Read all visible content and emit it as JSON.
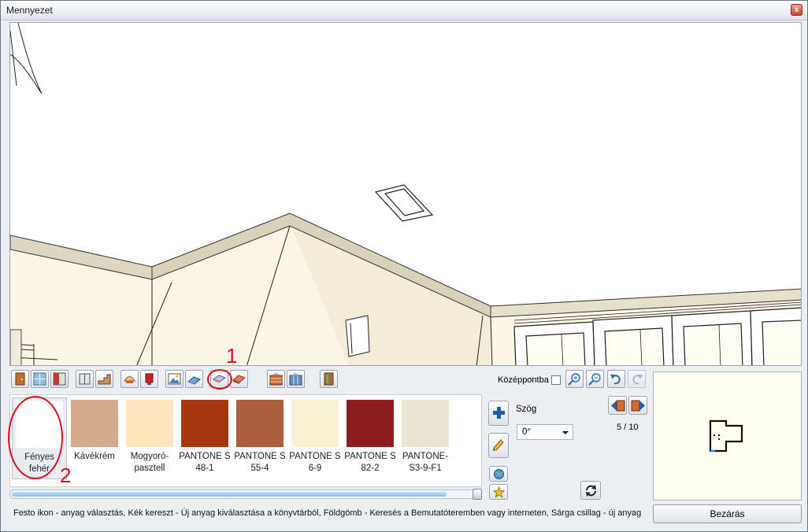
{
  "window": {
    "title": "Mennyezet",
    "close_glyph": "x"
  },
  "toolbar": {
    "buttons": [
      "door-icon",
      "window-icon",
      "wall-icon",
      "cabinet-icon",
      "stairs-icon",
      "lamp-icon",
      "paint-bucket-icon",
      "picture-icon",
      "floor-icon",
      "ceiling-icon",
      "roof-icon",
      "brick-wall-icon",
      "tile-icon",
      "wardrobe-icon"
    ],
    "center_label": "Középpontba",
    "center_checked": false
  },
  "swatches": [
    {
      "name": "Fényes fehér",
      "color": "#ffffff",
      "selected": true
    },
    {
      "name": "Kávékrém",
      "color": "#d3ab8c",
      "selected": false
    },
    {
      "name": "Mogyoró-pasztell",
      "color": "#fde6bd",
      "selected": false
    },
    {
      "name": "PANTONE S 48-1",
      "color": "#a7390f",
      "selected": false
    },
    {
      "name": "PANTONE S 55-4",
      "color": "#ad5e3c",
      "selected": false
    },
    {
      "name": "PANTONE S 6-9",
      "color": "#f8f0d2",
      "selected": false
    },
    {
      "name": "PANTONE S 82-2",
      "color": "#8d1d1f",
      "selected": false
    },
    {
      "name": "PANTONE-S3-9-F1",
      "color": "#e7e5d1",
      "selected": false
    }
  ],
  "side": {
    "angle_label": "Szög",
    "angle_value": "0°"
  },
  "navigation": {
    "page": "5 / 10"
  },
  "status": {
    "text": "Festo ikon - anyag választás, Kék kereszt - Új anyag kiválasztása a könyvtárból, Földgömb - Keresés a Bemutatóteremben vagy interneten, Sárga csillag - új anyag"
  },
  "footer": {
    "close_label": "Bezárás"
  },
  "annotations": {
    "label_1": "1",
    "label_2": "2",
    "color": "#e0101a"
  }
}
